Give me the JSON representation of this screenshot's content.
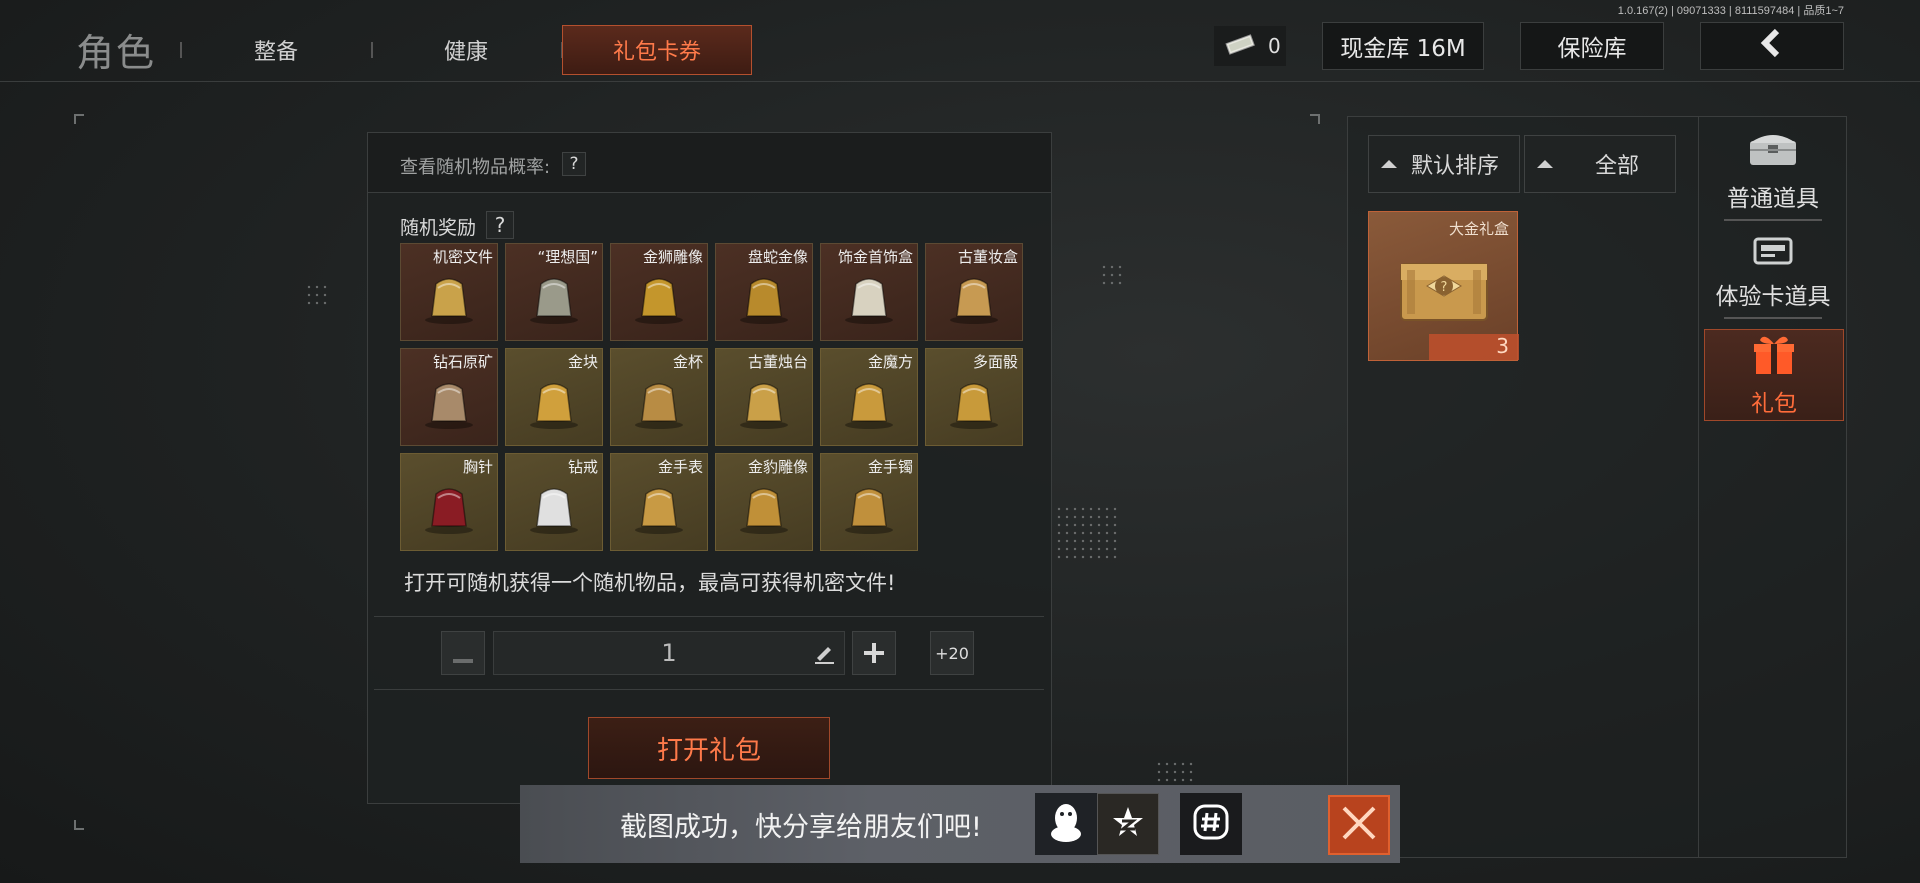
{
  "header": {
    "version": "1.0.167(2) | 09071333 | 8111597484 | 品质1~7",
    "title": "角色",
    "tabs": [
      {
        "label": "整备"
      },
      {
        "label": "健康"
      },
      {
        "label": "礼包卡券",
        "active": true
      }
    ],
    "currency_value": "0",
    "cash_vault_label": "现金库 16M",
    "safe_label": "保险库",
    "back_icon": "chevron-left-icon"
  },
  "dialog": {
    "prob_label": "查看随机物品概率:",
    "help_mark": "?",
    "reward_label": "随机奖励",
    "items": [
      {
        "name": "机密文件",
        "tier": "red"
      },
      {
        "name": "“理想国”",
        "tier": "red"
      },
      {
        "name": "金狮雕像",
        "tier": "red"
      },
      {
        "name": "盘蛇金像",
        "tier": "red"
      },
      {
        "name": "饰金首饰盒",
        "tier": "red"
      },
      {
        "name": "古董妆盒",
        "tier": "red"
      },
      {
        "name": "钻石原矿",
        "tier": "red"
      },
      {
        "name": "金块",
        "tier": "gold"
      },
      {
        "name": "金杯",
        "tier": "gold"
      },
      {
        "name": "古董烛台",
        "tier": "gold"
      },
      {
        "name": "金魔方",
        "tier": "gold"
      },
      {
        "name": "多面骰",
        "tier": "gold"
      },
      {
        "name": "胸针",
        "tier": "gold"
      },
      {
        "name": "钻戒",
        "tier": "gold"
      },
      {
        "name": "金手表",
        "tier": "gold"
      },
      {
        "name": "金豹雕像",
        "tier": "gold"
      },
      {
        "name": "金手镯",
        "tier": "gold"
      }
    ],
    "description": "打开可随机获得一个随机物品，最高可获得机密文件!",
    "quantity": "1",
    "plus_twenty": "+20",
    "open_button": "打开礼包"
  },
  "right_panel": {
    "sort_label": "默认排序",
    "filter_label": "全部",
    "gift": {
      "name": "大金礼盒",
      "count": "3"
    },
    "categories": [
      {
        "label": "普通道具",
        "icon": "chest-icon"
      },
      {
        "label": "体验卡道具",
        "icon": "card-icon"
      },
      {
        "label": "礼包",
        "icon": "gift-icon",
        "active": true
      }
    ]
  },
  "toast": {
    "message": "截图成功，快分享给朋友们吧!"
  },
  "colors": {
    "accent": "#ff7a4a",
    "accent_border": "#b4502e",
    "item_red_bg": "#4c3024",
    "item_gold_bg": "#5a4e2d"
  }
}
